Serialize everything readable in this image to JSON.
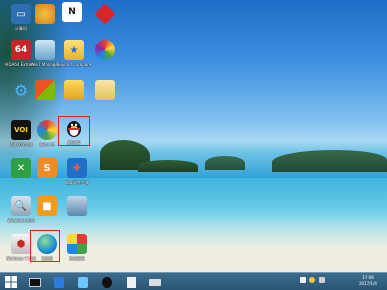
{
  "desktop": {
    "icons": [
      {
        "label": "计算机",
        "icon": "computer-icon"
      },
      {
        "label": "",
        "icon": "paint-icon"
      },
      {
        "label": "",
        "icon": "nero-icon"
      },
      {
        "label": "",
        "icon": "red-diamond-icon"
      },
      {
        "label": "AIDA64 Extreme",
        "icon": "aida64-icon"
      },
      {
        "label": "Win7 Manager",
        "icon": "recycle-bin-icon"
      },
      {
        "label": "Beyond Compare",
        "icon": "folder-star-icon"
      },
      {
        "label": "",
        "icon": "color-wheel-icon"
      },
      {
        "label": "",
        "icon": "settings-gear-icon"
      },
      {
        "label": "",
        "icon": "windows-update-icon"
      },
      {
        "label": "",
        "icon": "folder-app-icon"
      },
      {
        "label": "",
        "icon": "document-folder-icon"
      },
      {
        "label": "VOI 优化大师",
        "icon": "voi-icon"
      },
      {
        "label": "驱动人生",
        "icon": "browser-icon"
      },
      {
        "label": "腾讯QQ",
        "icon": "qq-penguin-icon"
      },
      {
        "label": "",
        "icon": "green-x-icon"
      },
      {
        "label": "",
        "icon": "orange-document-icon"
      },
      {
        "label": "卸载软件工具",
        "icon": "uninstall-tool-icon"
      },
      {
        "label": "Windows 优化",
        "icon": "windows-tool-icon"
      },
      {
        "label": "",
        "icon": "orange-app-icon"
      },
      {
        "label": "",
        "icon": "installer-icon"
      },
      {
        "label": "Windows 7 优化",
        "icon": "toolbox-icon"
      },
      {
        "label": "浏览器",
        "icon": "ie-globe-icon"
      },
      {
        "label": "驱动精灵",
        "icon": "driver-icon"
      }
    ]
  },
  "taskbar": {
    "items": [
      {
        "icon": "start-icon"
      },
      {
        "icon": "terminal-icon"
      },
      {
        "icon": "app-icon"
      },
      {
        "icon": "qq-taskbar-icon"
      },
      {
        "icon": "penguin-taskbar-icon"
      },
      {
        "icon": "document-taskbar-icon"
      },
      {
        "icon": "printer-taskbar-icon"
      }
    ],
    "time": "17:08",
    "date": "2017/1/4"
  }
}
